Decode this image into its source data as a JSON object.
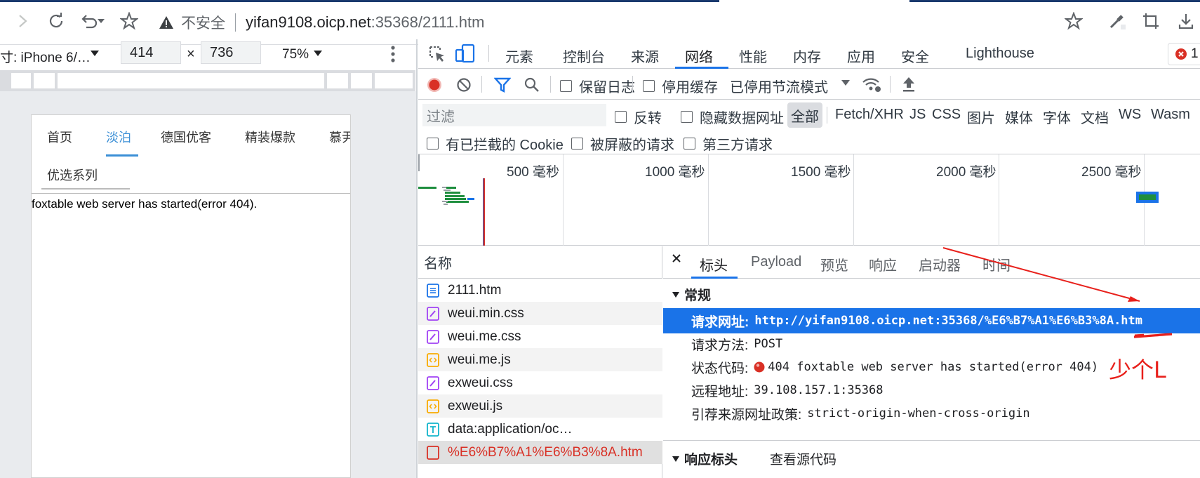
{
  "browser": {
    "insecure_label": "不安全",
    "url_host": "yifan9108.oicp.net",
    "url_rest": ":35368/2111.htm"
  },
  "device_bar": {
    "device_label": "寸: iPhone 6/…",
    "width": "414",
    "times": "×",
    "height": "736",
    "zoom": "75%"
  },
  "page": {
    "tabs": [
      "首页",
      "淡泊",
      "德国优客",
      "精装爆款",
      "慕尹"
    ],
    "active_tab": "淡泊",
    "sub_tab": "优选系列",
    "message": "foxtable web server has started(error 404).",
    "tab_active_color": "#3b8fd6"
  },
  "devtools": {
    "tabs": [
      "元素",
      "控制台",
      "来源",
      "网络",
      "性能",
      "内存",
      "应用",
      "安全",
      "Lighthouse"
    ],
    "active_tab": "网络",
    "error_count": "1",
    "toolbar": {
      "preserve_log": "保留日志",
      "disable_cache": "停用缓存",
      "throttle": "已停用节流模式"
    },
    "filter": {
      "placeholder": "过滤",
      "invert": "反转",
      "hide_data_urls": "隐藏数据网址",
      "all": "全部",
      "types": [
        "Fetch/XHR",
        "JS",
        "CSS",
        "图片",
        "媒体",
        "字体",
        "文档",
        "WS",
        "Wasm"
      ]
    },
    "cookie_filters": [
      "有已拦截的 Cookie",
      "被屏蔽的请求",
      "第三方请求"
    ],
    "timeline_ticks": [
      "500 毫秒",
      "1000 毫秒",
      "1500 毫秒",
      "2000 毫秒",
      "2500 毫秒"
    ],
    "request_list": {
      "header": "名称",
      "rows": [
        {
          "name": "2111.htm",
          "icon": "document-icon"
        },
        {
          "name": "weui.min.css",
          "icon": "stylesheet-icon"
        },
        {
          "name": "weui.me.css",
          "icon": "stylesheet-icon"
        },
        {
          "name": "weui.me.js",
          "icon": "script-icon"
        },
        {
          "name": "exweui.css",
          "icon": "stylesheet-icon"
        },
        {
          "name": "exweui.js",
          "icon": "script-icon"
        },
        {
          "name": "data:application/oc…",
          "icon": "text-icon"
        },
        {
          "name": "%E6%B7%A1%E6%B3%8A.htm",
          "icon": "error-doc-icon",
          "error": true
        }
      ]
    },
    "detail": {
      "tabs": [
        "标头",
        "Payload",
        "预览",
        "响应",
        "启动器",
        "时间"
      ],
      "active_tab": "标头",
      "general_title": "常规",
      "rows": [
        {
          "key": "请求网址:",
          "value": "http://yifan9108.oicp.net:35368/%E6%B7%A1%E6%B3%8A.htm"
        },
        {
          "key": "请求方法:",
          "value": "POST"
        },
        {
          "key": "状态代码:",
          "value": "404 foxtable web server has started(error 404)"
        },
        {
          "key": "远程地址:",
          "value": "39.108.157.1:35368"
        },
        {
          "key": "引荐来源网址政策:",
          "value": "strict-origin-when-cross-origin"
        }
      ],
      "response_headers_title": "响应标头",
      "view_source": "查看源代码"
    }
  },
  "annotation": {
    "text": "少个L",
    "color": "#e8201b"
  },
  "colors": {
    "accent": "#1a73e8",
    "record_red": "#d93025",
    "error_red": "#d93025"
  }
}
